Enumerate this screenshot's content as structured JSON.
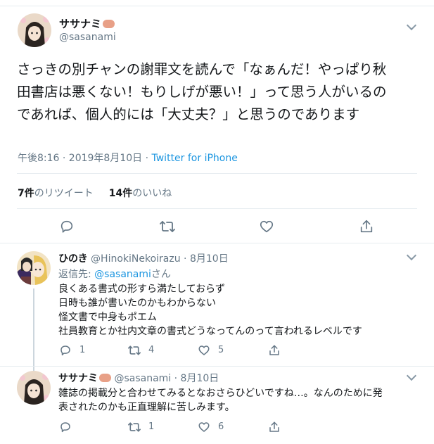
{
  "main_tweet": {
    "name": "ササナミ",
    "handle": "@sasanami",
    "text": "さっきの別チャンの謝罪文を読んで「なぁんだ！やっぱり秋田書店は悪くない！もりしげが悪い！」って思う人がいるのであれば、個人的には「大丈夫？」と思うのであります",
    "time": "午後8:16 · 2019年8月10日 · ",
    "via": "Twitter for iPhone",
    "retweets_count": "7件",
    "retweets_label": "のリツイート",
    "likes_count": "14件",
    "likes_label": "のいいね"
  },
  "replies": [
    {
      "name": "ひのき",
      "handle": "@HinokiNekoirazu",
      "date": "8月10日",
      "reply_to_prefix": "返信先: ",
      "reply_to_handle": "@sasanami",
      "reply_to_suffix": "さん",
      "lines": [
        "良くある書式の形すら満たしておらず",
        "日時も誰が書いたのかもわからない",
        "怪文書で中身もポエム",
        "社員教育とか社内文章の書式どうなってんのって言われるレベルです"
      ],
      "reply_count": "1",
      "retweet_count": "4",
      "like_count": "5"
    },
    {
      "name": "ササナミ",
      "handle": "@sasanami",
      "date": "8月10日",
      "lines": [
        "雑誌の掲載分と合わせてみるとなおさらひどいですね…。なんのために発",
        "表されたのかも正直理解に苦しみます。"
      ],
      "reply_count": "",
      "retweet_count": "1",
      "like_count": "6"
    }
  ],
  "colors": {
    "text": "#14171a",
    "secondary": "#657786",
    "link": "#1b95e0",
    "border": "#e6ecf0",
    "icon": "#657786"
  }
}
